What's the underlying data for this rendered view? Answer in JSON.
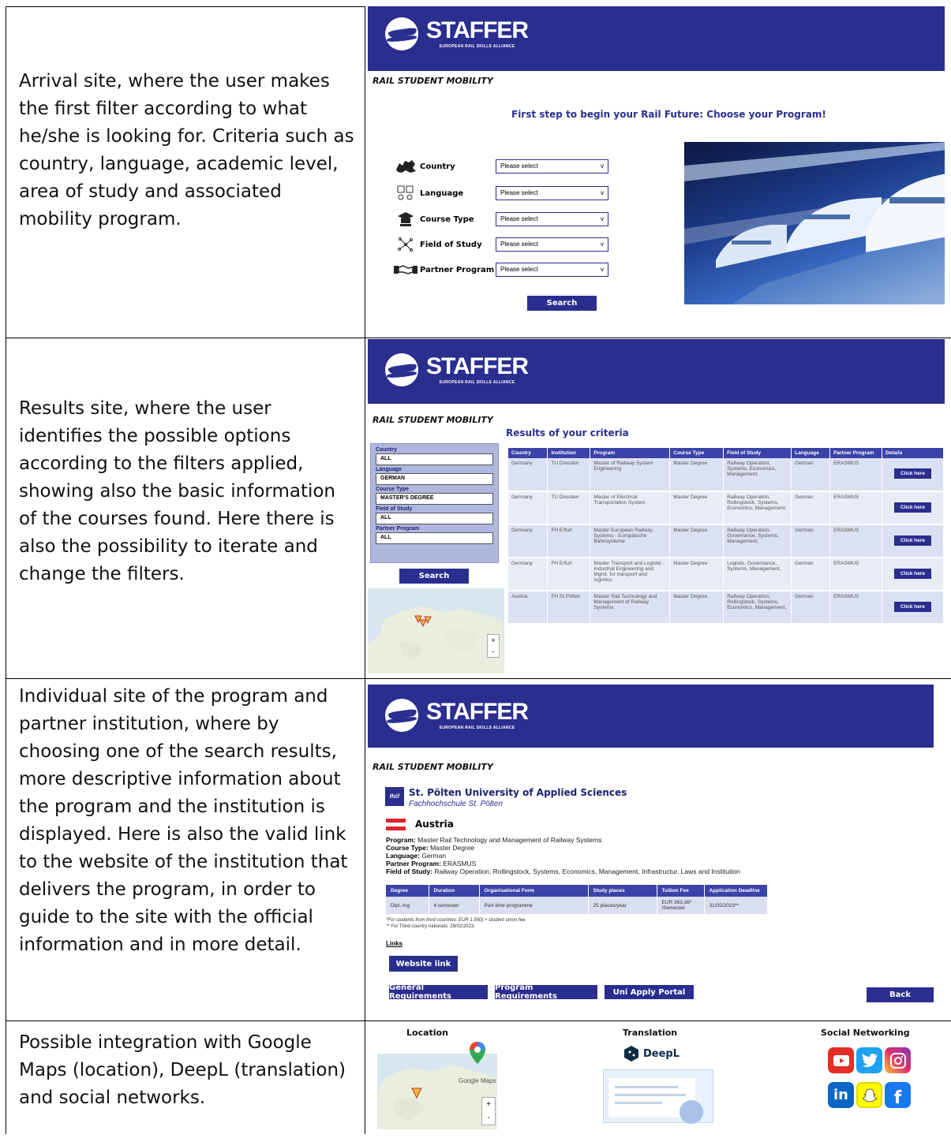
{
  "rows": [
    {
      "description": "Arrival site, where the user makes the first filter according to what he/she is looking for. Criteria such as country, language, academic level, area of study and associated mobility program."
    },
    {
      "description": "Results site, where the user identifies the possible options according to the filters applied, showing also the basic information of the courses found. Here there is also the possibility to iterate and change the filters."
    },
    {
      "description": "Individual site of the program and partner institution, where by choosing one of the search results, more descriptive information about the program and the institution is displayed. Here is also the valid link to the website of the institution that delivers the program, in order to guide to the site with the official information and in more detail."
    },
    {
      "description": "Possible integration with Google Maps (location), DeepL (translation) and social networks."
    }
  ],
  "brand": {
    "name": "STAFFER",
    "subtitle": "EUROPEAN RAIL SKILLS ALLIANCE",
    "section": "RAIL STUDENT MOBILITY",
    "color": "#2a2e8f"
  },
  "arrival": {
    "headline": "First step to begin your Rail Future: Choose your Program!",
    "filters": [
      {
        "icon": "europe-map-icon",
        "label": "Country",
        "placeholder": "Please select"
      },
      {
        "icon": "language-icon",
        "label": "Language",
        "placeholder": "Please select"
      },
      {
        "icon": "graduation-cap-icon",
        "label": "Course Type",
        "placeholder": "Please select"
      },
      {
        "icon": "network-icon",
        "label": "Field of Study",
        "placeholder": "Please select"
      },
      {
        "icon": "handshake-icon",
        "label": "Partner Program",
        "placeholder": "Please select"
      }
    ],
    "chevron": "v",
    "search_label": "Search"
  },
  "results": {
    "title": "Results of your criteria",
    "filters": [
      {
        "label": "Country",
        "value": "ALL"
      },
      {
        "label": "Language",
        "value": "GERMAN"
      },
      {
        "label": "Course Type",
        "value": "MASTER'S DEGREE"
      },
      {
        "label": "Field of Study",
        "value": "ALL"
      },
      {
        "label": "Partner Program",
        "value": "ALL"
      }
    ],
    "search_label": "Search",
    "columns": [
      "Country",
      "Institution",
      "Program",
      "Course Type",
      "Field of Study",
      "Language",
      "Partner Program",
      "Details"
    ],
    "rows": [
      [
        "Germany",
        "TU Dresden",
        "Master of Railway System Engineering",
        "Master Degree",
        "Railway Operation, Systems, Economics, Management,",
        "German",
        "ERASMUS"
      ],
      [
        "Germany",
        "TU Dresden",
        "Master of Electrical Transportation System",
        "Master Degree",
        "Railway Operation, Rollingstock, Systems, Economics, Management,",
        "German",
        "ERASMUS"
      ],
      [
        "Germany",
        "FH Erfurt",
        "Master European Railway Systems - Europäische Bahnsysteme",
        "Master Degree",
        "Railway Operation, Governance, Systems, Management,",
        "German",
        "ERASMUS"
      ],
      [
        "Germany",
        "FH Erfurt",
        "Master Transport and Logistic - Industrial Engineering and Mgmt. for transport and logistics",
        "Master Degree",
        "Logistic, Governance, Systems, Management,",
        "German",
        "ERASMUS"
      ],
      [
        "Austria",
        "FH St Pölten",
        "Master Rail Technology and Management of Railway Systems",
        "Master Degree",
        "Railway Operation, Rollingstock, Systems, Economics, Management,",
        "German",
        "ERASMUS"
      ]
    ],
    "click_label": "Click here"
  },
  "detail": {
    "institution": "St. Pölten University of Applied Sciences",
    "institution_sub": "Fachhochschule St. Pölten",
    "institution_logo": "fh///",
    "country": "Austria",
    "fields": [
      {
        "key": "Program:",
        "value": "Master Rail Technology and Management of Railway Systems"
      },
      {
        "key": "Course Type:",
        "value": "Master Degree"
      },
      {
        "key": "Language:",
        "value": "German"
      },
      {
        "key": "Partner Program:",
        "value": "ERASMUS"
      },
      {
        "key": "Field of Study:",
        "value": "Railway Operation, Rollingstock, Systems, Economics, Management, Infrastructur, Laws and Institution"
      }
    ],
    "columns": [
      "Degree",
      "Duration",
      "Organisational Form",
      "Study places",
      "Tuition Fee",
      "Application Deadline"
    ],
    "row": [
      "Dipl.-Ing",
      "4 semester",
      "Part-time programme",
      "25 places/year",
      "EUR 363,36* /Semester",
      "31/05/2023**"
    ],
    "note1": "*For students from third countries: EUR 1.500) + student union fee.",
    "note2": "** For Third-country nationals: 28/02/2023.",
    "links_label": "Links",
    "website_label": "Website link",
    "general_label": "General Requirements",
    "program_label": "Program Requirements",
    "apply_label": "Uni Apply Portal",
    "back_label": "Back"
  },
  "integrations": {
    "location_title": "Location",
    "translation_title": "Translation",
    "social_title": "Social Networking",
    "google_maps_label": "Google Maps",
    "deepl_label": "DeepL"
  }
}
